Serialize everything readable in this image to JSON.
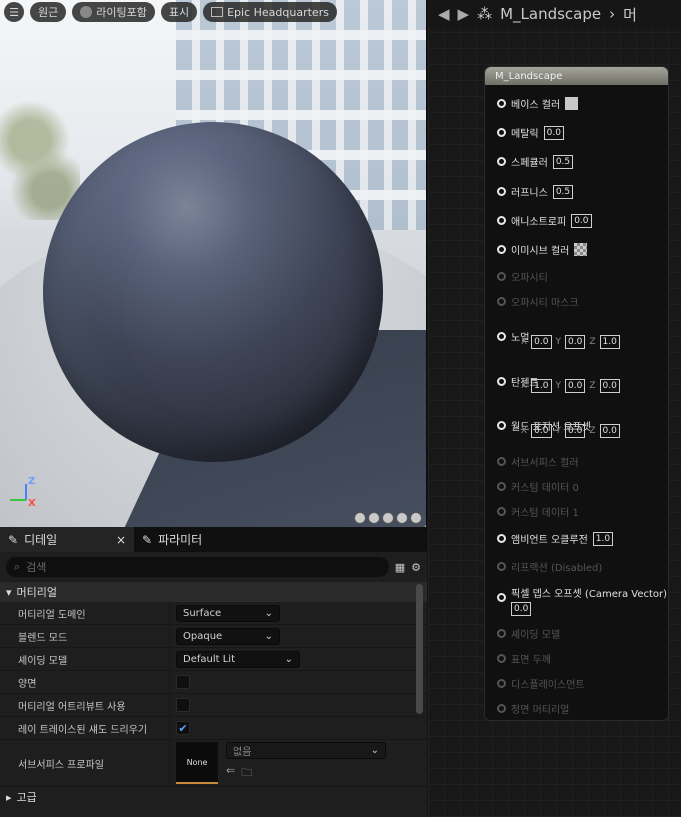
{
  "viewport": {
    "toolbar": {
      "perspective_label": "원근",
      "lighting_label": "라이팅포함",
      "show_label": "표시",
      "hdri_label": "Epic Headquarters"
    },
    "axis": {
      "z": "Z",
      "x": "X"
    }
  },
  "details": {
    "tabs": [
      {
        "label": "디테일",
        "close": "×"
      },
      {
        "label": "파라미터"
      }
    ],
    "search_placeholder": "검색",
    "section_material": "머티리얼",
    "rows": [
      {
        "label": "머티리얼 도메인",
        "value": "Surface"
      },
      {
        "label": "블렌드 모드",
        "value": "Opaque"
      },
      {
        "label": "셰이딩 모델",
        "value": "Default Lit"
      },
      {
        "label": "양면",
        "checked": false
      },
      {
        "label": "머티리얼 어트리뷰트 사용",
        "checked": false
      },
      {
        "label": "레이 트레이스된 섀도 드리우기",
        "checked": true
      },
      {
        "label": "서브서피스 프로파일",
        "thumb": "None",
        "value": "없음"
      }
    ],
    "section_advanced": "고급"
  },
  "graph": {
    "breadcrumb": "M_Landscape",
    "breadcrumb_tail": "머",
    "node": {
      "title": "M_Landscape",
      "pins": [
        {
          "label": "베이스 컬러"
        },
        {
          "label": "메탈릭",
          "value": "0.0"
        },
        {
          "label": "스페큘러",
          "value": "0.5"
        },
        {
          "label": "러프니스",
          "value": "0.5"
        },
        {
          "label": "애니소트로피",
          "value": "0.0"
        },
        {
          "label": "이미시브 컬러"
        },
        {
          "label": "오파시티"
        },
        {
          "label": "오파시티 마스크"
        },
        {
          "label": "노멀",
          "x": "0.0",
          "y": "0.0",
          "z": "1.0"
        },
        {
          "label": "탄젠트",
          "x": "1.0",
          "y": "0.0",
          "z": "0.0"
        },
        {
          "label": "월드 포지션 오프셋",
          "x": "0.0",
          "y": "0.0",
          "z": "0.0"
        },
        {
          "label": "서브서피스 컬러"
        },
        {
          "label": "커스텀 데이터 0"
        },
        {
          "label": "커스텀 데이터 1"
        },
        {
          "label": "앰비언트 오클루전",
          "value": "1.0"
        },
        {
          "label": "리프랙션 (Disabled)"
        },
        {
          "label": "픽셀 뎁스 오프셋 (Camera Vector)",
          "value": "0.0"
        },
        {
          "label": "셰이딩 모델"
        },
        {
          "label": "표면 두께"
        },
        {
          "label": "디스플레이스먼트"
        },
        {
          "label": "정면 머티리얼"
        }
      ]
    }
  }
}
